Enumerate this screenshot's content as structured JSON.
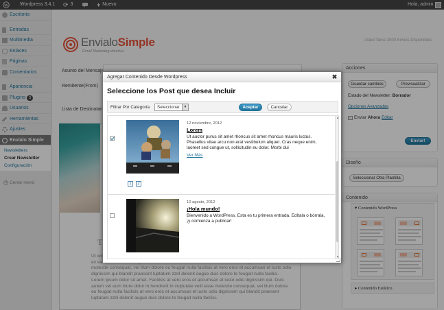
{
  "admin_bar": {
    "wp_version": "Wordpress 3.4.1",
    "updates_count": "3",
    "new_label": "Nuevo",
    "greeting": "Hola, admin"
  },
  "menu": {
    "items": [
      {
        "label": "Escritorio",
        "icon": "dashboard-icon"
      },
      {
        "label": "Entradas",
        "icon": "pin-icon"
      },
      {
        "label": "Multimedia",
        "icon": "media-icon"
      },
      {
        "label": "Enlaces",
        "icon": "links-icon"
      },
      {
        "label": "Páginas",
        "icon": "pages-icon"
      },
      {
        "label": "Comentarios",
        "icon": "comments-icon"
      },
      {
        "label": "Apariencia",
        "icon": "appearance-icon"
      },
      {
        "label": "Plugins",
        "icon": "plugins-icon",
        "badge": "3"
      },
      {
        "label": "Usuarios",
        "icon": "users-icon"
      },
      {
        "label": "Herramientas",
        "icon": "tools-icon"
      },
      {
        "label": "Ajustes",
        "icon": "settings-icon"
      },
      {
        "label": "Envialo Simple",
        "icon": "envialo-icon"
      }
    ],
    "submenu": [
      "Newsletters",
      "Crear Newsletter",
      "Configuración"
    ],
    "collapse": "Cerrar menú"
  },
  "brand": {
    "name_a": "Envialo",
    "name_b": "Simple",
    "tagline": "Email Marketing efectivo.",
    "accent": "#e8533a"
  },
  "quota": "Usted Tiene 2000 Envios Disponibles",
  "form": {
    "asunto": "Asunto del Mensaje",
    "remitente": "Remitente(From)",
    "lista": "Lista de Destinatarios"
  },
  "editor": {
    "heading_initial": "T",
    "lorem": "Ut wisi enim ad minim veniam, quis nostrud exerci tation ullamcorper suscipit lobortis nisl ut aliquip ex ea commodo consequat. Duis autem vel eum iriure dolor in hendrerit in vulputate velit esse molestie consequat, vel illum dolore eu feugiat nulla facilisis at vero eros et accumsan et iusto odio dignissim qui blandit praesent luptatum zzril delenit augue duis dolore te feugait nulla facilisi. Lorem ipsum dolor sit amet. Facilisis at vero eros et accumsan et iusto odio dignissim qui. Duis autem vel eum iriure dolor in hendrerit in vulputate velit esse molestie consequat, vel illum dolore eu feugiat nulla facilisis at vero eros et accumsan et iusto odio dignissim qui blandit praesent luptatum zzril delenit augue duis dolore te feugait nulla facilisi."
  },
  "acciones": {
    "title": "Acciones",
    "save": "Guardar cambios",
    "preview": "Previsualizar",
    "status_label": "Estado del Newsletter:",
    "status_value": "Borrador",
    "advanced": "Opciones Avanzadas",
    "send_label": "Enviar",
    "send_when": "Ahora",
    "edit": "Editar",
    "send_button": "Enviar!"
  },
  "diseno": {
    "title": "Diseño",
    "select_template": "Seleccionar Otra Plantilla"
  },
  "contenido": {
    "title": "Contenido",
    "wp": "Contenido WordPress",
    "static": "Contenido Estático",
    "tpl_label": "TITULO"
  },
  "modal": {
    "title": "Agregar Contenido Desde Wordpress",
    "heading": "Seleccione los Post que desea Incluir",
    "filter_label": "Filtrar Por Categoría",
    "select_value": "Seleccionar",
    "accept": "Aceptar",
    "cancel": "Cancelar",
    "posts": [
      {
        "date": "12 noviembre, 2012",
        "title": "Lorem",
        "excerpt": "Ut auctor purus sit amet rhoncus sit amet rhoncus mauris luctus. Phasellus vitae arcu non erat vestibulum aliquet. Cras neque enim, laoreet sed congue ut, sollicitudin eu dolor. Morbi dui",
        "more": "Ver Más",
        "checked": true
      },
      {
        "date": "10 agosto, 2012",
        "title": "¡Hola mundo!",
        "excerpt": "Bienvenido a WordPress. Esta es tu primera entrada. Edítala o bórrala, ¡y comienza a publicar!",
        "more": "",
        "checked": false
      }
    ],
    "pages": [
      "1",
      "2"
    ]
  }
}
